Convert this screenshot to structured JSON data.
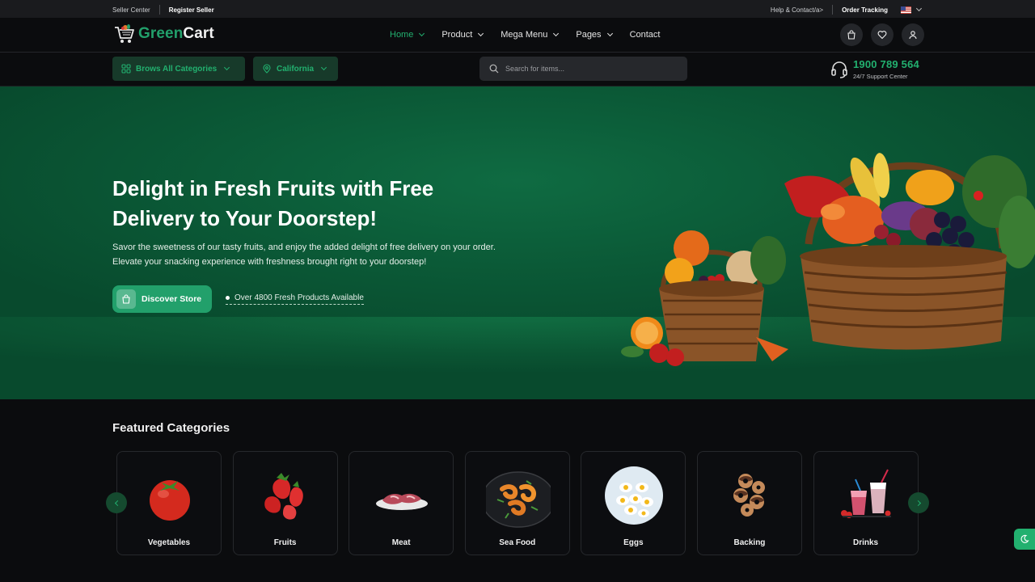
{
  "topbar": {
    "seller_center": "Seller Center",
    "register_seller": "Register Seller",
    "help": "Help & Contact/a>",
    "order_tracking": "Order Tracking"
  },
  "header": {
    "logo_green": "Green",
    "logo_white": "Cart",
    "nav": [
      {
        "label": "Home",
        "active": true,
        "dropdown": true
      },
      {
        "label": "Product",
        "active": false,
        "dropdown": true
      },
      {
        "label": "Mega Menu",
        "active": false,
        "dropdown": true
      },
      {
        "label": "Pages",
        "active": false,
        "dropdown": true
      },
      {
        "label": "Contact",
        "active": false,
        "dropdown": false
      }
    ],
    "icons": [
      "shopping-bag-icon",
      "heart-icon",
      "user-icon"
    ]
  },
  "subheader": {
    "categories_label": "Brows All Categories",
    "location_label": "California",
    "search_placeholder": "Search for items...",
    "support_phone": "1900 789 564",
    "support_caption": "24/7 Support Center"
  },
  "hero": {
    "title": "Delight in Fresh Fruits with Free Delivery to Your Doorstep!",
    "description": "Savor the sweetness of our tasty fruits, and enjoy the added delight of free delivery on your order. Elevate your snacking experience with freshness brought right to your doorstep!",
    "cta_label": "Discover Store",
    "availability": "Over 4800 Fresh Products Available"
  },
  "featured": {
    "title": "Featured Categories",
    "categories": [
      {
        "label": "Vegetables",
        "icon": "tomato-icon"
      },
      {
        "label": "Fruits",
        "icon": "strawberry-icon"
      },
      {
        "label": "Meat",
        "icon": "meat-icon"
      },
      {
        "label": "Sea Food",
        "icon": "shrimp-icon"
      },
      {
        "label": "Eggs",
        "icon": "eggs-icon"
      },
      {
        "label": "Backing",
        "icon": "donuts-icon"
      },
      {
        "label": "Drinks",
        "icon": "drinks-icon"
      }
    ]
  },
  "colors": {
    "accent": "#22a06b",
    "hero_bg": "#0b5a37",
    "page_bg": "#0b0c0e"
  }
}
